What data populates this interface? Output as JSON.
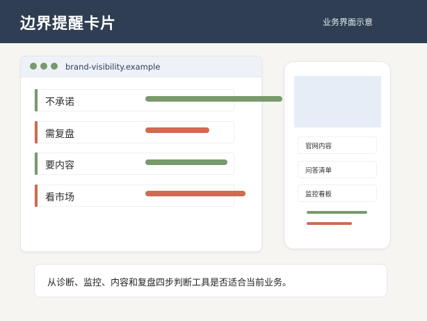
{
  "header": {
    "title": "边界提醒卡片",
    "subtitle": "业务界面示意"
  },
  "browser": {
    "url": "brand-visibility.example",
    "rows": [
      {
        "label": "不承诺",
        "color": "#789a6c"
      },
      {
        "label": "需复盘",
        "color": "#cf6b50"
      },
      {
        "label": "要内容",
        "color": "#789a6c"
      },
      {
        "label": "看市场",
        "color": "#cf6b50"
      }
    ]
  },
  "phone": {
    "items": [
      "官网内容",
      "问答清单",
      "监控看板"
    ]
  },
  "caption": "从诊断、监控、内容和复盘四步判断工具是否适合当前业务。",
  "colors": {
    "header_bg": "#2f3e52",
    "green": "#789a6c",
    "orange": "#cf6b50"
  }
}
